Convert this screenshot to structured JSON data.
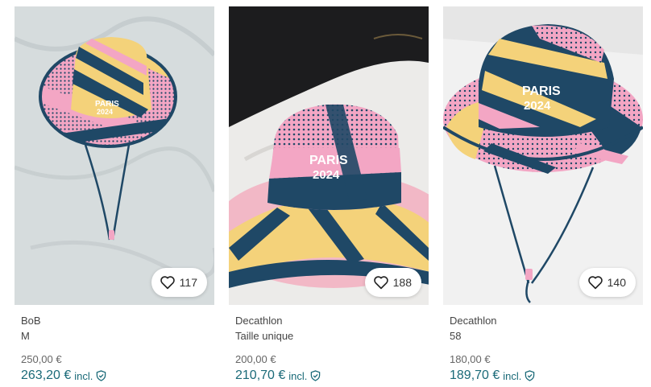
{
  "listings": [
    {
      "brand": "BoB",
      "size": "M",
      "price": "250,00 €",
      "price_incl": "263,20 €",
      "incl_label": "incl.",
      "favorites": "117"
    },
    {
      "brand": "Decathlon",
      "size": "Taille unique",
      "price": "200,00 €",
      "price_incl": "210,70 €",
      "incl_label": "incl.",
      "favorites": "188"
    },
    {
      "brand": "Decathlon",
      "size": "58",
      "price": "180,00 €",
      "price_incl": "189,70 €",
      "incl_label": "incl.",
      "favorites": "140"
    }
  ],
  "images": [
    {
      "logo_line1": "PARIS",
      "logo_line2": "2024"
    },
    {
      "logo_line1": "PARIS",
      "logo_line2": "2024"
    },
    {
      "logo_line1": "PARIS",
      "logo_line2": "2024"
    }
  ],
  "colors": {
    "accent": "#1a6a78",
    "hat_pink": "#f3a6c4",
    "hat_navy": "#1f4866",
    "hat_yellow": "#f4d27a"
  },
  "icons": {
    "favorite": "heart-icon",
    "buyer_protection": "shield-check-icon"
  }
}
